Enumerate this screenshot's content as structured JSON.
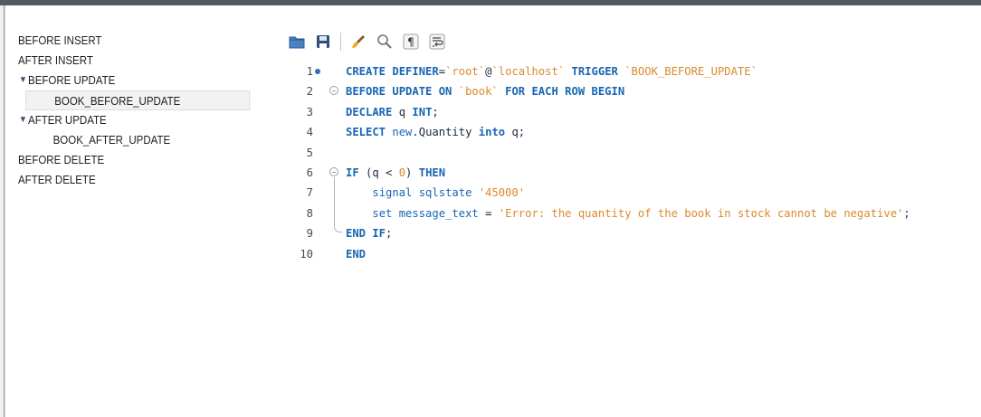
{
  "tree": {
    "items": [
      {
        "label": "BEFORE INSERT",
        "group": false,
        "indent": 0,
        "selected": false
      },
      {
        "label": "AFTER INSERT",
        "group": false,
        "indent": 0,
        "selected": false
      },
      {
        "label": "BEFORE UPDATE",
        "group": true,
        "indent": 0,
        "selected": false
      },
      {
        "label": "BOOK_BEFORE_UPDATE",
        "group": false,
        "indent": 1,
        "selected": true
      },
      {
        "label": "AFTER UPDATE",
        "group": true,
        "indent": 0,
        "selected": false
      },
      {
        "label": "BOOK_AFTER_UPDATE",
        "group": false,
        "indent": 1,
        "selected": false
      },
      {
        "label": "BEFORE DELETE",
        "group": false,
        "indent": 0,
        "selected": false
      },
      {
        "label": "AFTER DELETE",
        "group": false,
        "indent": 0,
        "selected": false
      }
    ],
    "expand_glyph": "▼"
  },
  "toolbar": {
    "icons": [
      "open-folder-icon",
      "save-icon",
      "beautify-brush-icon",
      "find-magnifier-icon",
      "show-invisibles-pilcrow-icon",
      "word-wrap-icon"
    ]
  },
  "editor": {
    "line_numbers": [
      "1",
      "2",
      "3",
      "4",
      "5",
      "6",
      "7",
      "8",
      "9",
      "10"
    ],
    "lines": [
      [
        {
          "t": "kw",
          "v": "CREATE DEFINER"
        },
        {
          "t": "pl",
          "v": "="
        },
        {
          "t": "str",
          "v": "`root`"
        },
        {
          "t": "pl",
          "v": "@"
        },
        {
          "t": "str",
          "v": "`localhost`"
        },
        {
          "t": "kw",
          "v": " TRIGGER "
        },
        {
          "t": "str",
          "v": "`BOOK_BEFORE_UPDATE`"
        }
      ],
      [
        {
          "t": "kw",
          "v": "BEFORE UPDATE ON "
        },
        {
          "t": "str",
          "v": "`book`"
        },
        {
          "t": "kw",
          "v": " FOR EACH ROW BEGIN"
        }
      ],
      [
        {
          "t": "kw",
          "v": "DECLARE "
        },
        {
          "t": "tx",
          "v": "q "
        },
        {
          "t": "kw",
          "v": "INT"
        },
        {
          "t": "pl",
          "v": ";"
        }
      ],
      [
        {
          "t": "kw",
          "v": "SELECT "
        },
        {
          "t": "fn",
          "v": "new"
        },
        {
          "t": "pl",
          "v": ".Quantity "
        },
        {
          "t": "kw",
          "v": "into "
        },
        {
          "t": "tx",
          "v": "q"
        },
        {
          "t": "pl",
          "v": ";"
        }
      ],
      [],
      [
        {
          "t": "kw",
          "v": "IF "
        },
        {
          "t": "pl",
          "v": "(q < "
        },
        {
          "t": "num",
          "v": "0"
        },
        {
          "t": "pl",
          "v": ") "
        },
        {
          "t": "kw",
          "v": "THEN"
        }
      ],
      [
        {
          "t": "pl",
          "v": "    "
        },
        {
          "t": "fn",
          "v": "signal sqlstate "
        },
        {
          "t": "str",
          "v": "'45000'"
        }
      ],
      [
        {
          "t": "pl",
          "v": "    "
        },
        {
          "t": "fn",
          "v": "set message_text "
        },
        {
          "t": "pl",
          "v": "= "
        },
        {
          "t": "str",
          "v": "'Error: the quantity of the book in stock cannot be negative'"
        },
        {
          "t": "pl",
          "v": ";"
        }
      ],
      [
        {
          "t": "kw",
          "v": "END IF"
        },
        {
          "t": "pl",
          "v": ";"
        }
      ],
      [
        {
          "t": "kw",
          "v": "END"
        }
      ]
    ],
    "breakpoint_line": "1",
    "fold_lines": [
      "2",
      "6"
    ],
    "fold_end_lines": [
      "9"
    ],
    "colors": {
      "keyword": "#1866b4",
      "string": "#d98a2b",
      "text": "#1a2a3a"
    }
  }
}
